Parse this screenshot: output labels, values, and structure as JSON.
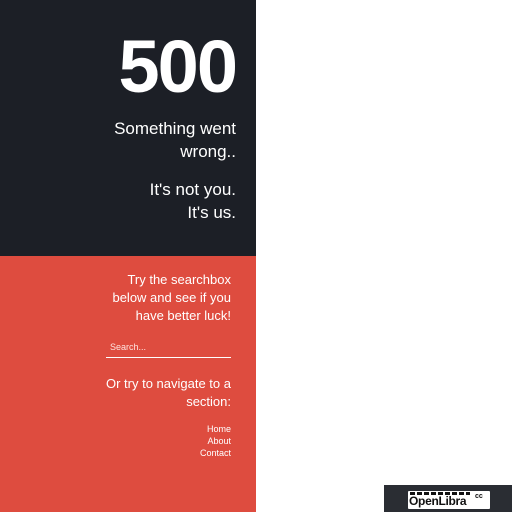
{
  "error": {
    "code": "500",
    "message_line_1": "Something went",
    "message_line_2": "wrong..",
    "reassure_line_1": "It's not you.",
    "reassure_line_2": "It's us."
  },
  "search": {
    "hint_line_1": "Try the searchbox",
    "hint_line_2": "below and see if you",
    "hint_line_3": "have better luck!",
    "placeholder": "Search..."
  },
  "navigation": {
    "hint_line_1": "Or try to navigate to a",
    "hint_line_2": "section:",
    "links": [
      "Home",
      "About",
      "Contact"
    ]
  },
  "brand": {
    "name": "OpenLibra",
    "tld": "cc"
  },
  "colors": {
    "dark_panel": "#1c1f26",
    "accent_red": "#de4c3f",
    "text": "#ffffff"
  }
}
